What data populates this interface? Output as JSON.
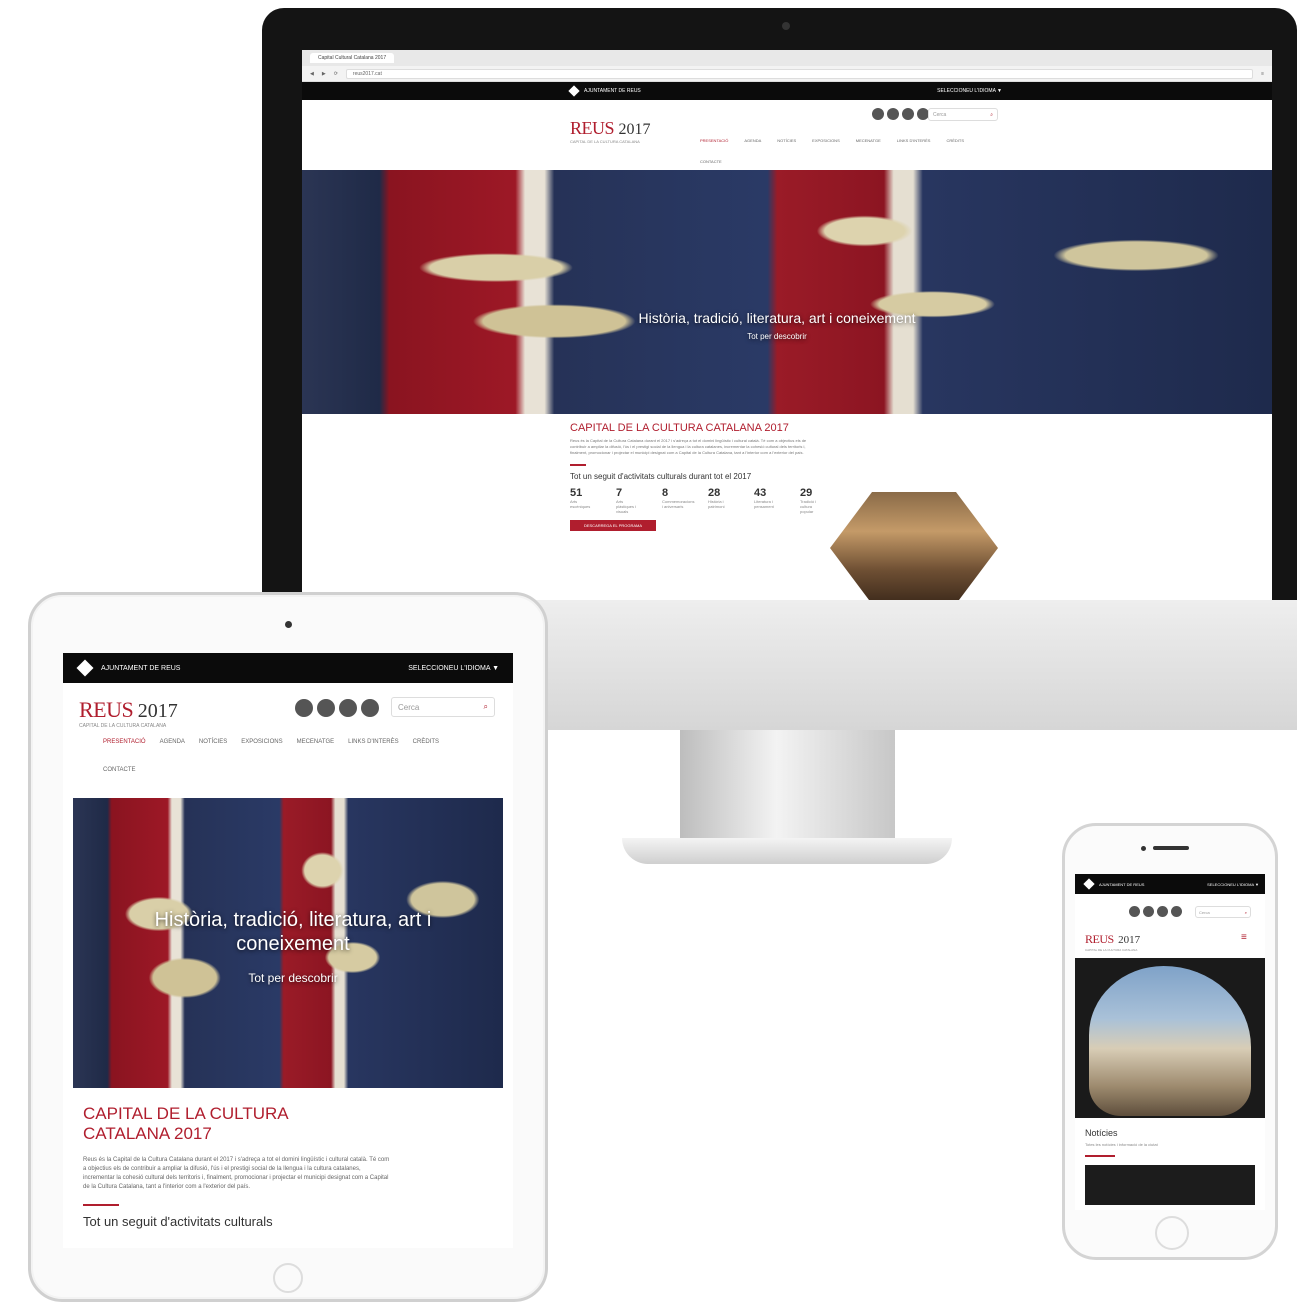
{
  "site": {
    "institution": "AJUNTAMENT DE REUS",
    "language_selector": "SELECCIONEU L'IDIOMA",
    "brand_name": "REUS",
    "brand_year": "2017",
    "brand_subtitle": "CAPITAL DE LA CULTURA CATALANA",
    "search_placeholder": "Cerca",
    "nav": [
      "PRESENTACIÓ",
      "AGENDA",
      "NOTÍCIES",
      "EXPOSICIONS",
      "MECENATGE",
      "LINKS D'INTERÈS",
      "CRÈDITS",
      "CONTACTE"
    ],
    "accent_color": "#b01e2e"
  },
  "desktop": {
    "tab_title": "Capital Cultural Catalana 2017",
    "url": "reus2017.cat",
    "hero_caption": "Història, tradició, literatura, art i coneixement",
    "hero_cta": "Tot per descobrir",
    "section_title": "CAPITAL DE LA CULTURA CATALANA 2017",
    "activities_title": "Tot un seguit d'activitats culturals durant tot el 2017",
    "stats": [
      {
        "value": "51",
        "label": "Arts escèniques"
      },
      {
        "value": "7",
        "label": "Arts plàstiques i visuals"
      },
      {
        "value": "8",
        "label": "Commemoracions i aniversaris"
      },
      {
        "value": "28",
        "label": "Història i patrimoni"
      },
      {
        "value": "43",
        "label": "Literatura i pensament"
      },
      {
        "value": "29",
        "label": "Tradició i cultura popular"
      }
    ],
    "program_button": "DESCARREGA EL PROGRAMA"
  },
  "tablet": {
    "hero_caption": "Història, tradició, literatura, art i coneixement",
    "hero_cta": "Tot per descobrir",
    "section_title": "CAPITAL DE LA CULTURA CATALANA 2017",
    "intro": "Reus és la Capital de la Cultura Catalana durant el 2017 i s'adreça a tot el domini lingüístic i cultural català. Té com a objectius els de contribuir a ampliar la difusió, l'ús i el prestigi social de la llengua i la cultura catalanes, incrementar la cohesió cultural dels territoris i, finalment, promocionar i projectar el municipi designat com a Capital de la Cultura Catalana, tant a l'interior com a l'exterior del país.",
    "activities_title": "Tot un seguit d'activitats culturals"
  },
  "mobile": {
    "news_title": "Notícies",
    "news_note": "Totes les notícies i informació de la ciutat"
  },
  "icons": {
    "social": [
      "facebook-icon",
      "twitter-icon",
      "instagram-icon",
      "youtube-icon"
    ],
    "search": "search-icon",
    "menu": "hamburger-icon",
    "dropdown": "caret-down-icon"
  }
}
